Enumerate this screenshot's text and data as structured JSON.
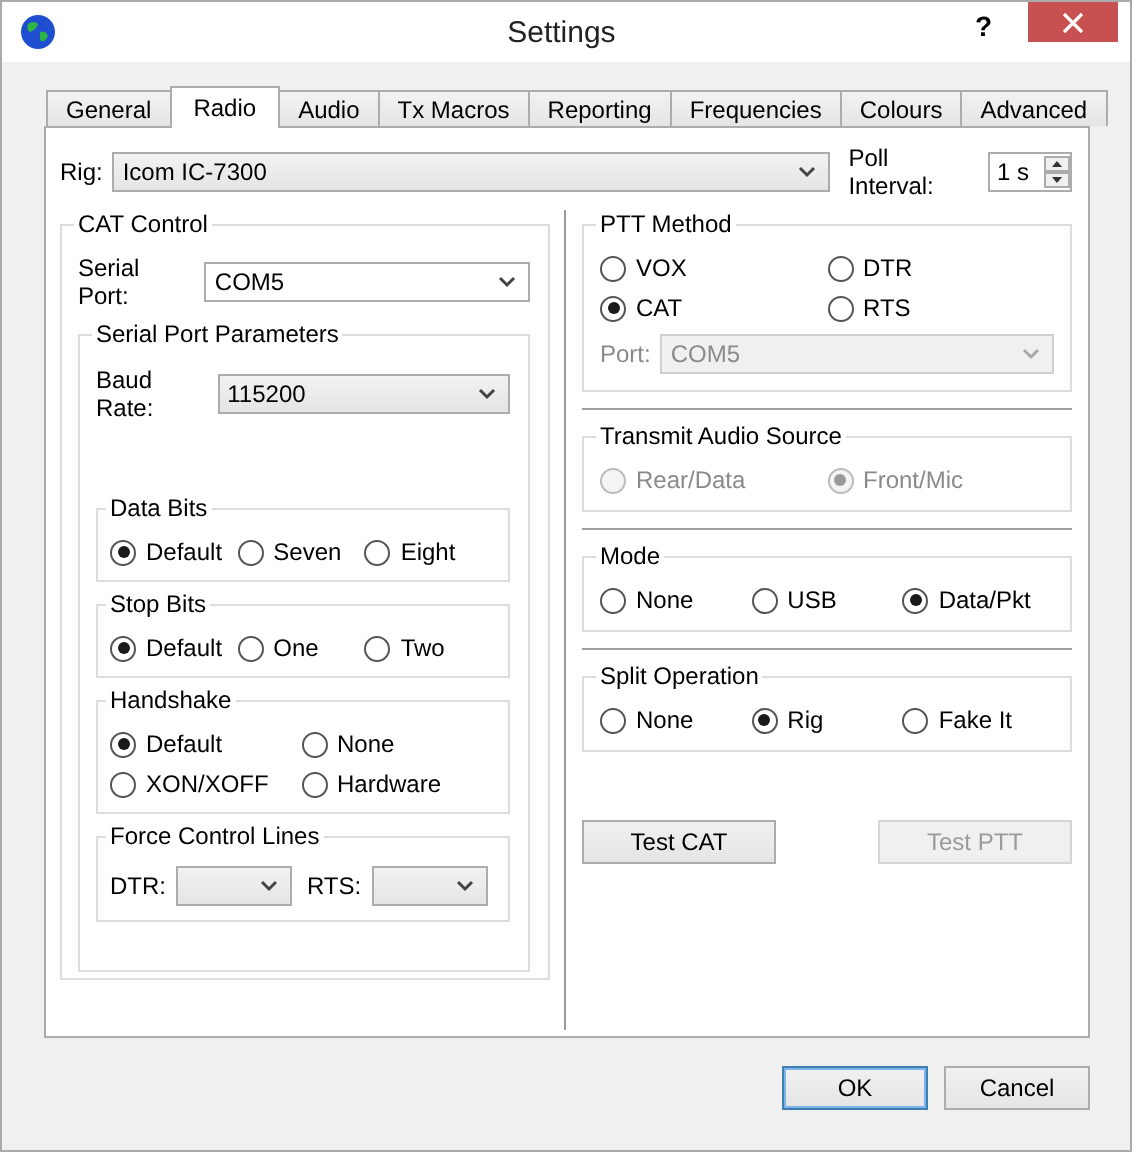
{
  "window": {
    "title": "Settings",
    "help": "?"
  },
  "tabs": [
    {
      "label": "General",
      "selected": false
    },
    {
      "label": "Radio",
      "selected": true
    },
    {
      "label": "Audio",
      "selected": false
    },
    {
      "label": "Tx Macros",
      "selected": false
    },
    {
      "label": "Reporting",
      "selected": false
    },
    {
      "label": "Frequencies",
      "selected": false
    },
    {
      "label": "Colours",
      "selected": false
    },
    {
      "label": "Advanced",
      "selected": false
    }
  ],
  "rig": {
    "label": "Rig:",
    "value": "Icom IC-7300"
  },
  "poll_interval": {
    "label": "Poll Interval:",
    "value": "1 s"
  },
  "cat_control": {
    "title": "CAT Control",
    "serial_port": {
      "label": "Serial Port:",
      "value": "COM5"
    },
    "serial_port_parameters": {
      "title": "Serial Port Parameters",
      "baud_rate": {
        "label": "Baud Rate:",
        "value": "115200"
      },
      "groups": [
        {
          "title": "Data Bits",
          "rows": [
            [
              {
                "label": "Default",
                "selected": true,
                "disabled": false
              },
              {
                "label": "Seven",
                "selected": false,
                "disabled": false
              },
              {
                "label": "Eight",
                "selected": false,
                "disabled": false
              }
            ]
          ]
        },
        {
          "title": "Stop Bits",
          "rows": [
            [
              {
                "label": "Default",
                "selected": true,
                "disabled": false
              },
              {
                "label": "One",
                "selected": false,
                "disabled": false
              },
              {
                "label": "Two",
                "selected": false,
                "disabled": false
              }
            ]
          ]
        },
        {
          "title": "Handshake",
          "rows": [
            [
              {
                "label": "Default",
                "selected": true,
                "disabled": false
              },
              {
                "label": "None",
                "selected": false,
                "disabled": false
              }
            ],
            [
              {
                "label": "XON/XOFF",
                "selected": false,
                "disabled": false
              },
              {
                "label": "Hardware",
                "selected": false,
                "disabled": false
              }
            ]
          ]
        }
      ],
      "force_control_lines": {
        "title": "Force Control Lines",
        "dtr": {
          "label": "DTR:"
        },
        "rts": {
          "label": "RTS:"
        }
      }
    }
  },
  "ptt_method": {
    "title": "PTT Method",
    "rows": [
      [
        {
          "label": "VOX",
          "selected": false,
          "disabled": false
        },
        {
          "label": "DTR",
          "selected": false,
          "disabled": false
        }
      ],
      [
        {
          "label": "CAT",
          "selected": true,
          "disabled": false
        },
        {
          "label": "RTS",
          "selected": false,
          "disabled": false
        }
      ]
    ],
    "port": {
      "label": "Port:",
      "value": "COM5",
      "disabled": true
    }
  },
  "right_groups": [
    {
      "title": "Transmit Audio Source",
      "rows": [
        [
          {
            "label": "Rear/Data",
            "selected": false,
            "disabled": true
          },
          {
            "label": "Front/Mic",
            "selected": true,
            "disabled": true
          }
        ]
      ]
    },
    {
      "title": "Mode",
      "rows": [
        [
          {
            "label": "None",
            "selected": false,
            "disabled": false
          },
          {
            "label": "USB",
            "selected": false,
            "disabled": false
          },
          {
            "label": "Data/Pkt",
            "selected": true,
            "disabled": false
          }
        ]
      ]
    },
    {
      "title": "Split Operation",
      "rows": [
        [
          {
            "label": "None",
            "selected": false,
            "disabled": false
          },
          {
            "label": "Rig",
            "selected": true,
            "disabled": false
          },
          {
            "label": "Fake It",
            "selected": false,
            "disabled": false
          }
        ]
      ]
    }
  ],
  "test_buttons": [
    {
      "label": "Test CAT",
      "disabled": false
    },
    {
      "label": "Test PTT",
      "disabled": true
    }
  ],
  "footer_buttons": [
    {
      "label": "OK",
      "default": true
    },
    {
      "label": "Cancel",
      "default": false
    }
  ]
}
